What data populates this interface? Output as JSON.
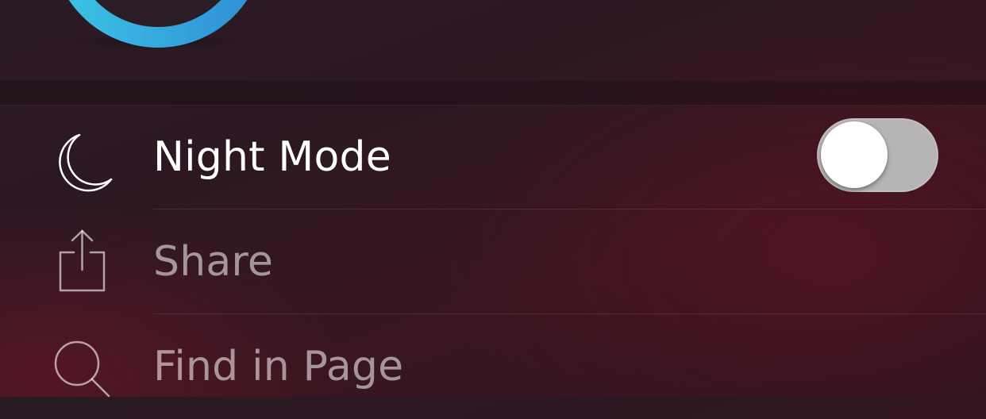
{
  "colors": {
    "ring_gradient_start": "#3cc3e4",
    "ring_gradient_end": "#2f8fd6",
    "toggle_track_off": "#b6b4b6",
    "label_active": "#ffffff",
    "label_dim": "rgba(255,255,255,0.55)"
  },
  "profile": {
    "avatar_icon": "profile-ring-icon"
  },
  "menu": {
    "night_mode": {
      "label": "Night Mode",
      "icon": "moon-icon",
      "toggle_on": false
    },
    "share": {
      "label": "Share",
      "icon": "share-icon"
    },
    "find_in_page": {
      "label": "Find in Page",
      "icon": "search-icon"
    }
  }
}
